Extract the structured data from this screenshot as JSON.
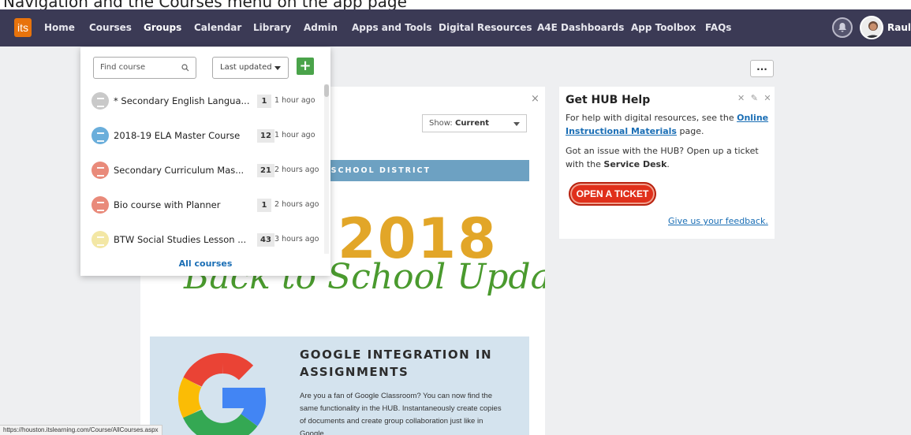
{
  "cropped_caption": "Navigation and the Courses menu on the app page",
  "nav": {
    "logo": "its",
    "items": [
      "Home",
      "Courses",
      "Groups",
      "Calendar",
      "Library",
      "Admin",
      "Apps and Tools",
      "Digital Resources",
      "A4E Dashboards",
      "App Toolbox",
      "FAQs"
    ],
    "active": "Groups",
    "user_name": "Raul",
    "bg_color": "#3b3a55",
    "logo_color": "#e8730c"
  },
  "more_button": "...",
  "courses_menu": {
    "search_placeholder": "Find course",
    "sort_selected": "Last updated",
    "add_label": "+",
    "courses": [
      {
        "name": "* Secondary English Langua...",
        "count": "1",
        "updated": "1 hour ago",
        "color": "#c9c9c9"
      },
      {
        "name": "2018-19 ELA Master Course",
        "count": "12",
        "updated": "1 hour ago",
        "color": "#6aaedb"
      },
      {
        "name": "Secondary Curriculum Mas...",
        "count": "21",
        "updated": "2 hours ago",
        "color": "#e98a7a"
      },
      {
        "name": "Bio course with Planner",
        "count": "1",
        "updated": "2 hours ago",
        "color": "#e98a7a"
      },
      {
        "name": "BTW Social Studies Lesson ...",
        "count": "43",
        "updated": "3 hours ago",
        "color": "#f3e7a5"
      }
    ],
    "all_courses_link": "All courses"
  },
  "news_widget": {
    "close_label": "×",
    "show_label": "Show:",
    "show_value": "Current",
    "district_banner": "ENT SCHOOL DISTRICT",
    "year": "2018",
    "headline": "Back to School Update",
    "google_title": "GOOGLE INTEGRATION IN ASSIGNMENTS",
    "google_body": "Are you a fan of Google Classroom? You can now find the same functionality in the HUB. Instantaneously create copies of documents and create group collaboration just like in Google"
  },
  "hub_help": {
    "title": "Get HUB Help",
    "tools": "✕ ✎ ✕",
    "text1_pre": "For help with digital resources, see the",
    "text1_link": "Online Instructional Materials",
    "text1_post": "page.",
    "text2_pre": "Got an issue with the HUB? Open up a ticket with the",
    "text2_bold": "Service Desk",
    "text2_post": ".",
    "ticket_button": "OPEN A TICKET",
    "feedback_link": "Give us your feedback."
  },
  "status_url": "https://houston.itslearning.com/Course/AllCourses.aspx"
}
